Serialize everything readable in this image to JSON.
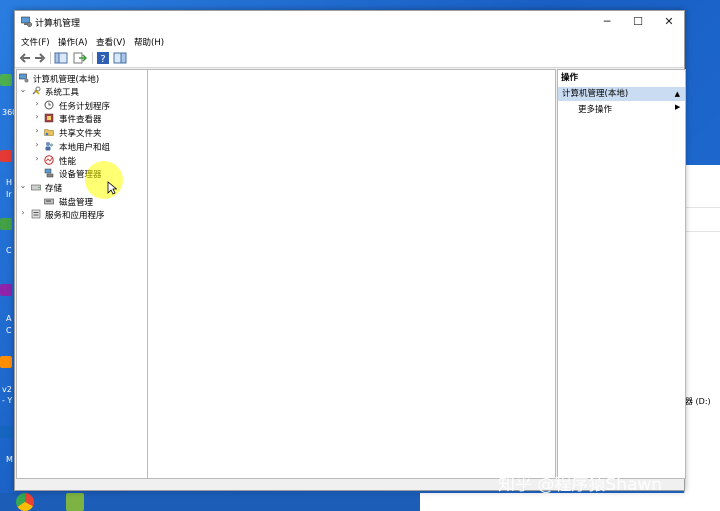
{
  "desktop": {
    "side_labels": [
      "360",
      "H",
      "Ir",
      "C",
      "A",
      "C",
      "v2",
      "- Y",
      "M"
    ],
    "right_window_text": "动器 (D:)",
    "watermark": "知乎 @程序猿Shawn"
  },
  "window": {
    "title": "计算机管理",
    "minimize": "─",
    "maximize": "☐",
    "close": "✕"
  },
  "menu": {
    "file": "文件(F)",
    "action": "操作(A)",
    "view": "查看(V)",
    "help": "帮助(H)"
  },
  "tree": {
    "root": "计算机管理(本地)",
    "system_tools": "系统工具",
    "task_scheduler": "任务计划程序",
    "event_viewer": "事件查看器",
    "shared_folders": "共享文件夹",
    "local_users": "本地用户和组",
    "performance": "性能",
    "device_manager": "设备管理器",
    "storage": "存储",
    "disk_management": "磁盘管理",
    "services_apps": "服务和应用程序"
  },
  "actions": {
    "header": "操作",
    "section": "计算机管理(本地)",
    "section_arrow": "▲",
    "more": "更多操作",
    "more_arrow": "▶"
  },
  "colors": {
    "desktop": "#1f6fd1",
    "selection": "#c9dcf2",
    "highlight": "#ffff00"
  }
}
